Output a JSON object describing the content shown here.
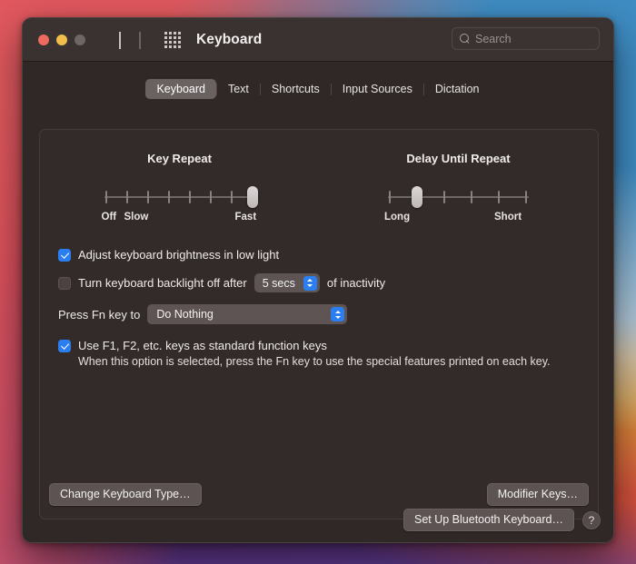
{
  "window": {
    "title": "Keyboard",
    "traffic_lights": [
      "close",
      "minimize",
      "zoom"
    ],
    "nav": {
      "back": "back-chevron",
      "forward": "forward-chevron",
      "grid": "show-all-grid"
    },
    "search": {
      "placeholder": "Search",
      "value": "",
      "icon": "search-icon"
    }
  },
  "tabs": [
    {
      "label": "Keyboard",
      "selected": true
    },
    {
      "label": "Text",
      "selected": false
    },
    {
      "label": "Shortcuts",
      "selected": false
    },
    {
      "label": "Input Sources",
      "selected": false
    },
    {
      "label": "Dictation",
      "selected": false
    }
  ],
  "sliders": {
    "key_repeat": {
      "title": "Key Repeat",
      "ticks": 8,
      "value_index": 7,
      "labels": {
        "off": "Off",
        "slow": "Slow",
        "fast": "Fast"
      }
    },
    "delay_until_repeat": {
      "title": "Delay Until Repeat",
      "ticks": 6,
      "value_index": 1,
      "labels": {
        "long": "Long",
        "short": "Short"
      }
    }
  },
  "options": {
    "adjust_brightness": {
      "label": "Adjust keyboard brightness in low light",
      "checked": true
    },
    "backlight_off": {
      "label_before": "Turn keyboard backlight off after",
      "label_after": "of inactivity",
      "checked": false,
      "stepper_value": "5 secs"
    },
    "fn_key": {
      "label": "Press Fn key to",
      "value": "Do Nothing"
    },
    "function_keys": {
      "label": "Use F1, F2, etc. keys as standard function keys",
      "checked": true,
      "description": "When this option is selected, press the Fn key to use the special features printed on each key."
    }
  },
  "buttons": {
    "change_keyboard_type": "Change Keyboard Type…",
    "modifier_keys": "Modifier Keys…",
    "set_up_bluetooth": "Set Up Bluetooth Keyboard…",
    "help": "?"
  },
  "colors": {
    "accent": "#2b7ef0",
    "window_bg": "#2f2827",
    "titlebar_bg": "#3a3231",
    "panel_bg": "#332b2a",
    "control_bg": "#5d5453",
    "text": "#efebeb"
  }
}
